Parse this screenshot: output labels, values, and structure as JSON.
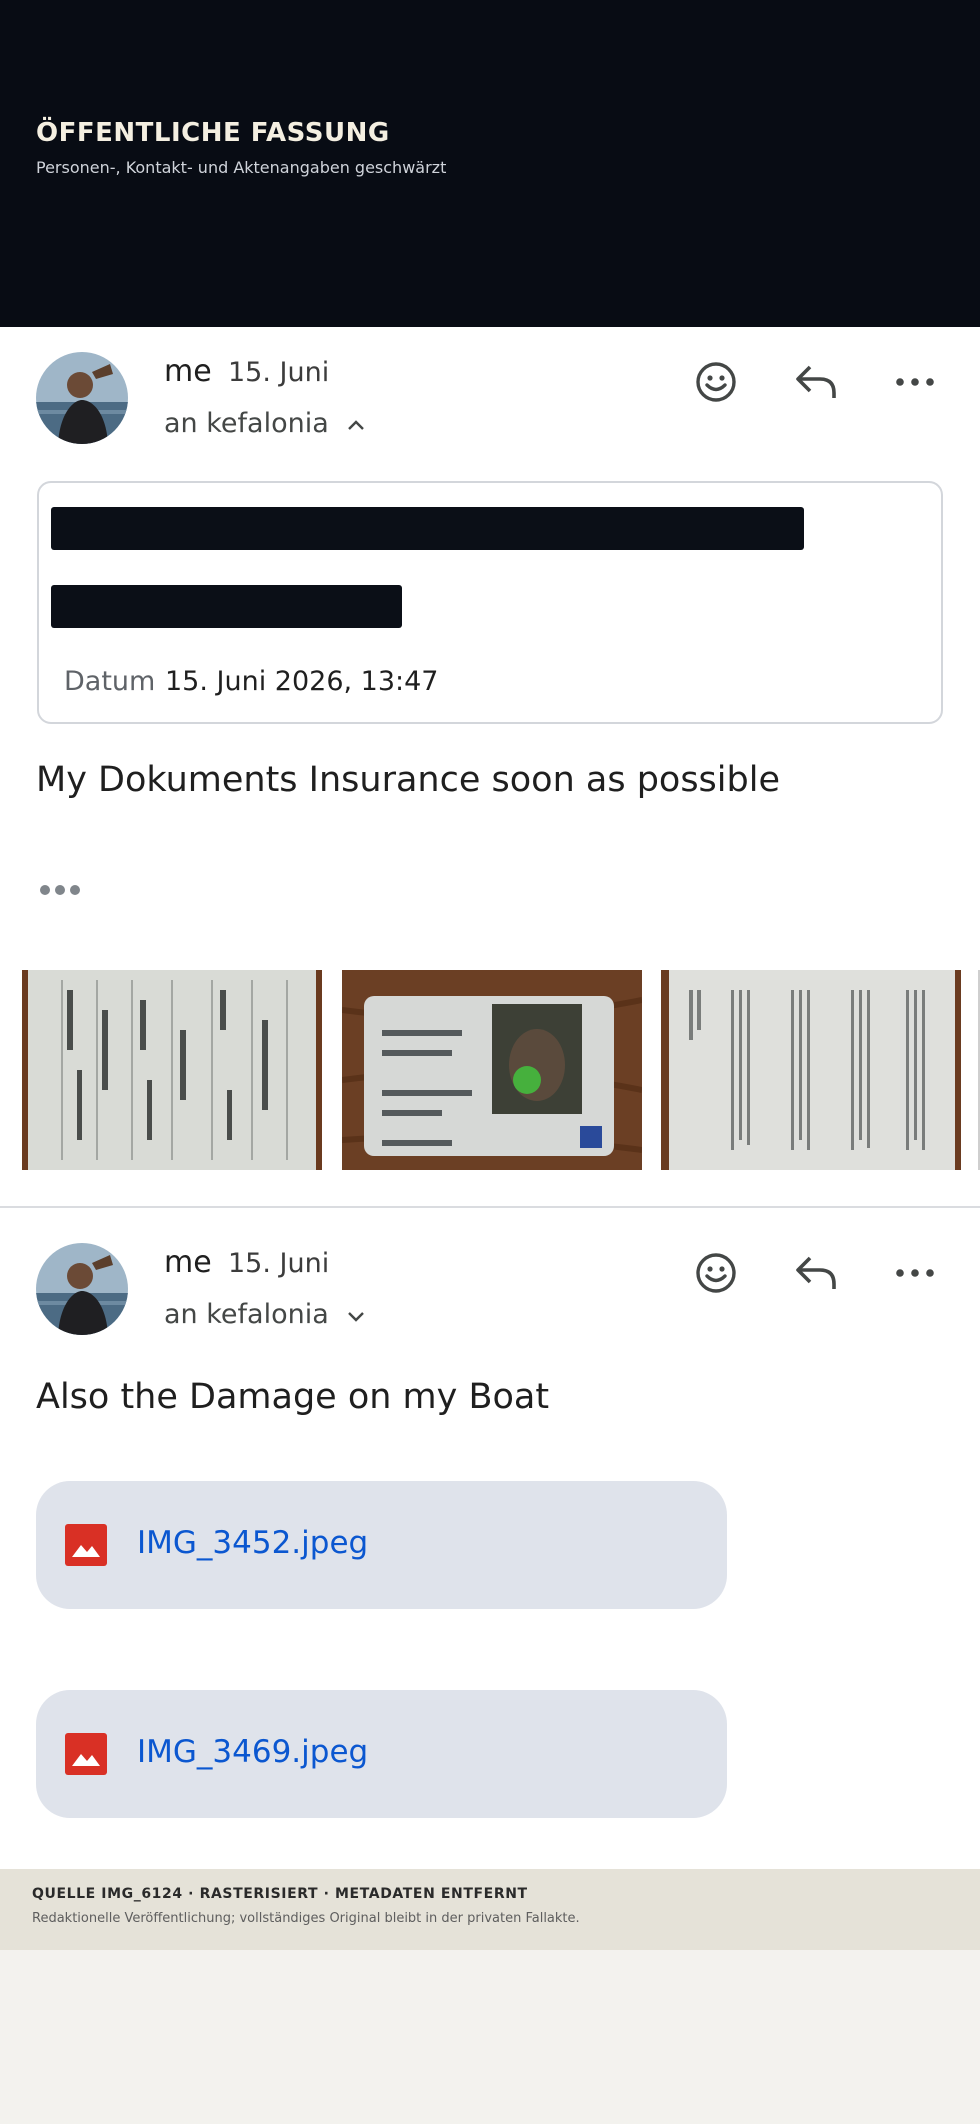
{
  "banner": {
    "title": "ÖFFENTLICHE FASSUNG",
    "subtitle": "Personen-, Kontakt- und Aktenangaben geschwärzt"
  },
  "messages": [
    {
      "sender": "me",
      "date": "15. Juni",
      "recipient": "an kefalonia",
      "recipient_expanded": true,
      "details": {
        "date_label": "Datum",
        "date_value": "15. Juni 2026, 13:47"
      },
      "body": "My Dokuments Insurance soon as possible"
    },
    {
      "sender": "me",
      "date": "15. Juni",
      "recipient": "an kefalonia",
      "recipient_expanded": false,
      "body": "Also the Damage on my Boat",
      "attachments": [
        {
          "name": "IMG_3452.jpeg",
          "icon": "image-file-icon"
        },
        {
          "name": "IMG_3469.jpeg",
          "icon": "image-file-icon"
        }
      ]
    }
  ],
  "actions": [
    "emoji-reaction-icon",
    "reply-icon",
    "more-options-icon"
  ],
  "colors": {
    "banner_bg": "#080c14",
    "link": "#0b57d0",
    "attachment_bg": "#dfe3eb",
    "redaction": "#0b0f17"
  },
  "footer": {
    "title": "QUELLE IMG_6124 · RASTERISIERT · METADATEN ENTFERNT",
    "subtitle": "Redaktionelle Veröffentlichung; vollständiges Original bleibt in der privaten Fallakte."
  }
}
